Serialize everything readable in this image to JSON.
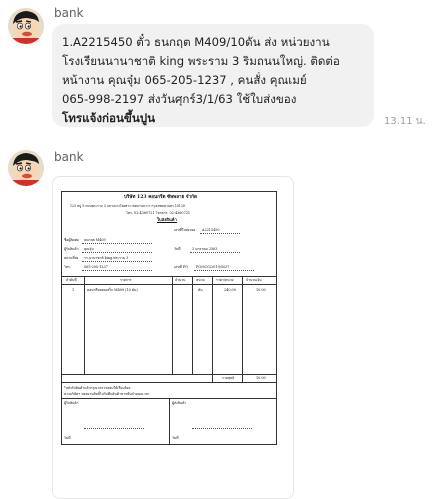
{
  "chat": {
    "messages": [
      {
        "sender": "bank",
        "lines": [
          {
            "text": "1.A2215450 ตั๋ว ธนกฤต M409/10ดัน  ส่ง หน่วยงาน",
            "bold": false
          },
          {
            "text": "โรงเรียนนานาชาติ king พระราม 3 ริมถนนใหญ่. ติดต่อ",
            "bold": false
          },
          {
            "text": "หน้างาน คุณจุ๋ม 065-205-1237 , คนสั่ง คุณเมย์",
            "bold": false
          },
          {
            "text": "065-998-2197 ส่งวันศุกร์3/1/63 ใช้ใบส่งของ",
            "bold": false
          },
          {
            "text": "โทรแจ้งก่อนขึ้นปูน",
            "bold": true
          }
        ],
        "time": "13.11 น."
      },
      {
        "sender": "bank",
        "attachment": {
          "company": "บริษัท 123 คอนกรีต ซัพพลาย จำกัด",
          "address": "123 หมู่ 5 ถนนพระราม 3 แขวงบางโพงพาง เขตยานนาวา กรุงเทพมหานคร 10120",
          "phone": "โทร. 02-4360721  โทรสาร. 02-4360721",
          "doc_title": "ใบส่งสินค้า",
          "doc_no_label": "เลขที่ใบส่งของ",
          "doc_no": "A2215450",
          "customer_label": "ชื่อผู้ติดต่อ",
          "customer": "ธนกฤต M409",
          "contact_label": "ผู้รับสินค้า",
          "contact": "คุณจุ๋ม",
          "date_label": "วันที่",
          "date": "3 มกราคม 2563",
          "place_label": "สถานที่ส่ง",
          "place": "รร.นานาชาติ king พระราม 3",
          "tel_label": "โทร.",
          "tel": "065-205-1237",
          "po_label": "เลขที่ PO",
          "po": "PO/SCG/2019/0037",
          "col_no": "ลำดับที่",
          "col_item": "รายการ",
          "col_qty": "จำนวน",
          "col_unit": "หน่วย",
          "col_price": "ราคา/หน่วย",
          "col_amount": "จำนวนเงิน",
          "row_no": "1",
          "row_item": "คอนกรีตผสมเสร็จ M409 (10 ตัน)",
          "row_unit": "ตัน",
          "row_price": "240.00",
          "row_amount": "10.00",
          "total_label": "รวมสุทธิ",
          "total": "10.00",
          "note1": "*หลังรับสินค้าแล้วกรุณาตรวจสอบให้เรียบร้อย",
          "note2": "ทางบริษัทฯ ขอสงวนสิทธิ์ไม่รับคืนสินค้าหากพ้นกำหนดเวลา",
          "sign1": "ผู้รับสินค้า",
          "sign2": "ผู้ส่งสินค้า",
          "date_sign1": "วันที่",
          "date_sign2": "วันที่"
        }
      }
    ]
  },
  "colors": {
    "bubble": "#f1f1f1",
    "sender": "#616161",
    "time": "#9e9e9e"
  },
  "icons": {
    "avatar": "cartoon-boy-avatar-icon"
  }
}
